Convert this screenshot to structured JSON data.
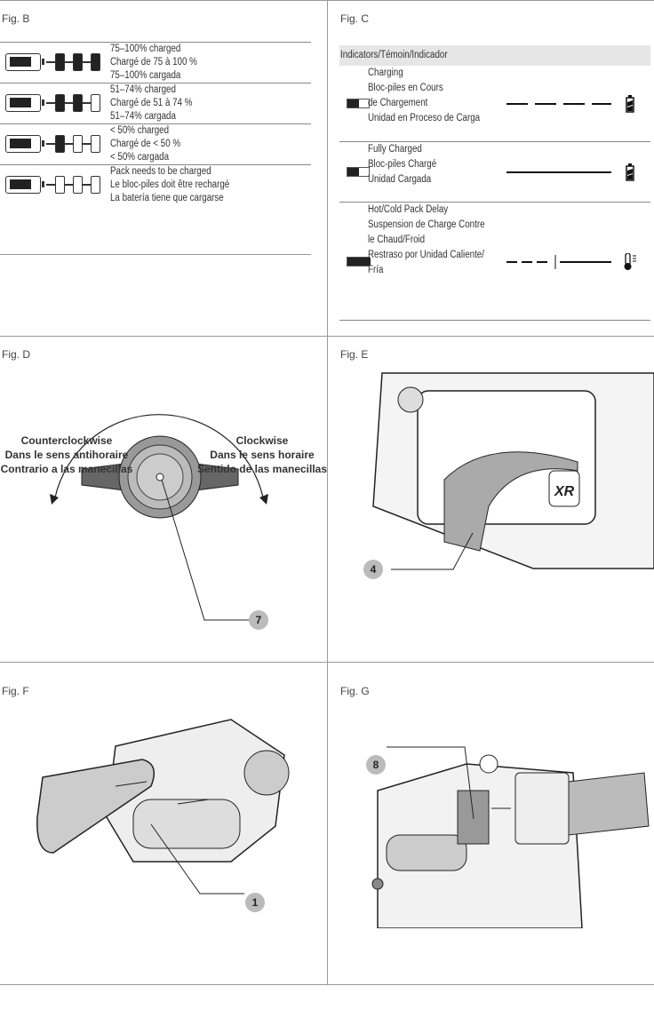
{
  "fig_b": {
    "label": "Fig. B",
    "rows": [
      {
        "filled": 3,
        "lines": [
          "75–100% charged",
          "Chargé de 75 à 100 %",
          "75–100% cargada"
        ]
      },
      {
        "filled": 2,
        "lines": [
          "51–74% charged",
          "Chargé de 51 à 74 %",
          "51–74% cargada"
        ]
      },
      {
        "filled": 1,
        "lines": [
          "< 50% charged",
          "Chargé de < 50 %",
          "< 50% cargada"
        ]
      },
      {
        "filled": 0,
        "lines": [
          "Pack needs to be charged",
          "Le bloc-piles doit être rechargé",
          "La batería tiene que cargarse"
        ]
      }
    ]
  },
  "fig_c": {
    "label": "Fig. C",
    "header": "Indicators/Témoin/Indicador",
    "rows": [
      {
        "lines": [
          "Charging",
          "Bloc-piles en Cours",
          "de Chargement",
          "Unidad en Proceso de Carga"
        ],
        "indicator": "blinking-dashed",
        "icon": "battery-charging-icon"
      },
      {
        "lines": [
          "Fully Charged",
          "Bloc-piles Chargé",
          "Unidad Cargada"
        ],
        "indicator": "solid",
        "icon": "battery-full-icon"
      },
      {
        "lines": [
          "Hot/Cold Pack Delay",
          "Suspension de Charge Contre",
          "le Chaud/Froid",
          "Restraso por Unidad Caliente/",
          "Fría"
        ],
        "indicator": "dashed-then-solid",
        "icon": "thermometer-icon"
      }
    ]
  },
  "fig_d": {
    "label": "Fig. D",
    "ccw": [
      "Counterclockwise",
      "Dans le sens antihoraire",
      "Contrario a las manecillas"
    ],
    "cw": [
      "Clockwise",
      "Dans le sens horaire",
      "Sentido de las manecillas"
    ],
    "callout": "7"
  },
  "fig_e": {
    "label": "Fig. E",
    "callout": "4",
    "logo": "XR"
  },
  "fig_f": {
    "label": "Fig. F",
    "callout": "1"
  },
  "fig_g": {
    "label": "Fig. G",
    "callout": "8"
  }
}
